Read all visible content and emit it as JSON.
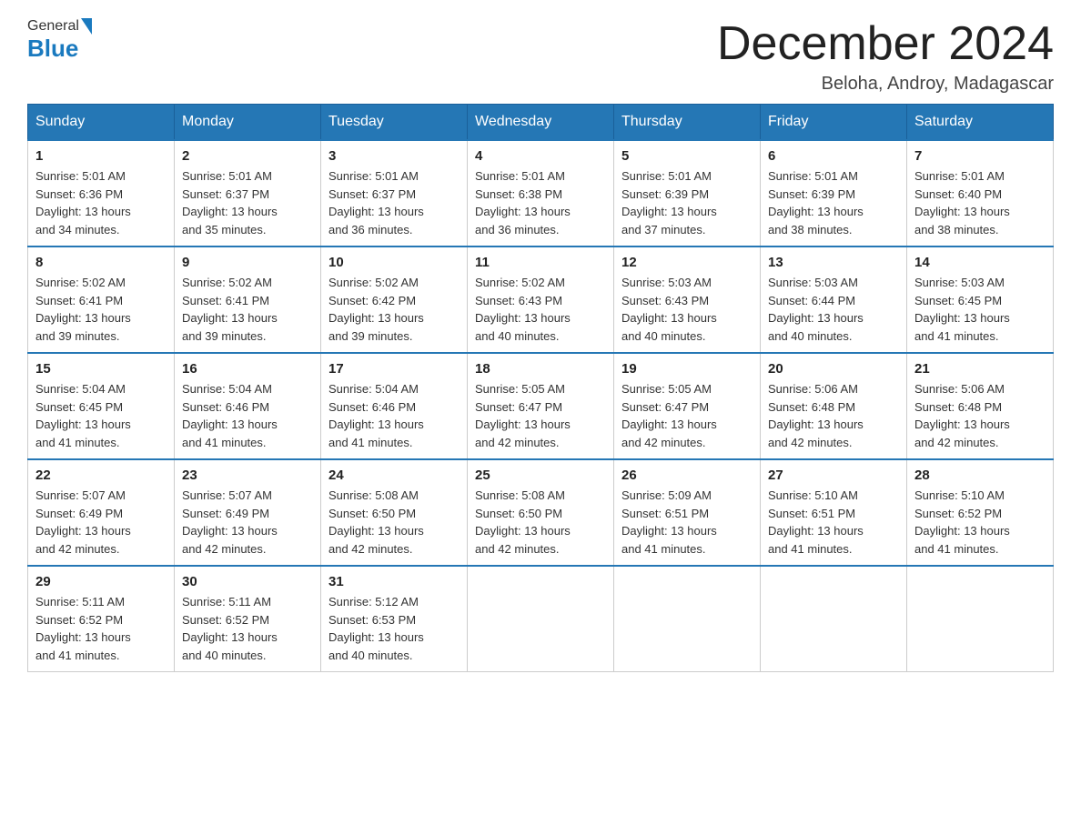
{
  "header": {
    "logo_general": "General",
    "logo_blue": "Blue",
    "month_title": "December 2024",
    "location": "Beloha, Androy, Madagascar"
  },
  "weekdays": [
    "Sunday",
    "Monday",
    "Tuesday",
    "Wednesday",
    "Thursday",
    "Friday",
    "Saturday"
  ],
  "weeks": [
    [
      {
        "day": "1",
        "sunrise": "5:01 AM",
        "sunset": "6:36 PM",
        "daylight": "13 hours and 34 minutes."
      },
      {
        "day": "2",
        "sunrise": "5:01 AM",
        "sunset": "6:37 PM",
        "daylight": "13 hours and 35 minutes."
      },
      {
        "day": "3",
        "sunrise": "5:01 AM",
        "sunset": "6:37 PM",
        "daylight": "13 hours and 36 minutes."
      },
      {
        "day": "4",
        "sunrise": "5:01 AM",
        "sunset": "6:38 PM",
        "daylight": "13 hours and 36 minutes."
      },
      {
        "day": "5",
        "sunrise": "5:01 AM",
        "sunset": "6:39 PM",
        "daylight": "13 hours and 37 minutes."
      },
      {
        "day": "6",
        "sunrise": "5:01 AM",
        "sunset": "6:39 PM",
        "daylight": "13 hours and 38 minutes."
      },
      {
        "day": "7",
        "sunrise": "5:01 AM",
        "sunset": "6:40 PM",
        "daylight": "13 hours and 38 minutes."
      }
    ],
    [
      {
        "day": "8",
        "sunrise": "5:02 AM",
        "sunset": "6:41 PM",
        "daylight": "13 hours and 39 minutes."
      },
      {
        "day": "9",
        "sunrise": "5:02 AM",
        "sunset": "6:41 PM",
        "daylight": "13 hours and 39 minutes."
      },
      {
        "day": "10",
        "sunrise": "5:02 AM",
        "sunset": "6:42 PM",
        "daylight": "13 hours and 39 minutes."
      },
      {
        "day": "11",
        "sunrise": "5:02 AM",
        "sunset": "6:43 PM",
        "daylight": "13 hours and 40 minutes."
      },
      {
        "day": "12",
        "sunrise": "5:03 AM",
        "sunset": "6:43 PM",
        "daylight": "13 hours and 40 minutes."
      },
      {
        "day": "13",
        "sunrise": "5:03 AM",
        "sunset": "6:44 PM",
        "daylight": "13 hours and 40 minutes."
      },
      {
        "day": "14",
        "sunrise": "5:03 AM",
        "sunset": "6:45 PM",
        "daylight": "13 hours and 41 minutes."
      }
    ],
    [
      {
        "day": "15",
        "sunrise": "5:04 AM",
        "sunset": "6:45 PM",
        "daylight": "13 hours and 41 minutes."
      },
      {
        "day": "16",
        "sunrise": "5:04 AM",
        "sunset": "6:46 PM",
        "daylight": "13 hours and 41 minutes."
      },
      {
        "day": "17",
        "sunrise": "5:04 AM",
        "sunset": "6:46 PM",
        "daylight": "13 hours and 41 minutes."
      },
      {
        "day": "18",
        "sunrise": "5:05 AM",
        "sunset": "6:47 PM",
        "daylight": "13 hours and 42 minutes."
      },
      {
        "day": "19",
        "sunrise": "5:05 AM",
        "sunset": "6:47 PM",
        "daylight": "13 hours and 42 minutes."
      },
      {
        "day": "20",
        "sunrise": "5:06 AM",
        "sunset": "6:48 PM",
        "daylight": "13 hours and 42 minutes."
      },
      {
        "day": "21",
        "sunrise": "5:06 AM",
        "sunset": "6:48 PM",
        "daylight": "13 hours and 42 minutes."
      }
    ],
    [
      {
        "day": "22",
        "sunrise": "5:07 AM",
        "sunset": "6:49 PM",
        "daylight": "13 hours and 42 minutes."
      },
      {
        "day": "23",
        "sunrise": "5:07 AM",
        "sunset": "6:49 PM",
        "daylight": "13 hours and 42 minutes."
      },
      {
        "day": "24",
        "sunrise": "5:08 AM",
        "sunset": "6:50 PM",
        "daylight": "13 hours and 42 minutes."
      },
      {
        "day": "25",
        "sunrise": "5:08 AM",
        "sunset": "6:50 PM",
        "daylight": "13 hours and 42 minutes."
      },
      {
        "day": "26",
        "sunrise": "5:09 AM",
        "sunset": "6:51 PM",
        "daylight": "13 hours and 41 minutes."
      },
      {
        "day": "27",
        "sunrise": "5:10 AM",
        "sunset": "6:51 PM",
        "daylight": "13 hours and 41 minutes."
      },
      {
        "day": "28",
        "sunrise": "5:10 AM",
        "sunset": "6:52 PM",
        "daylight": "13 hours and 41 minutes."
      }
    ],
    [
      {
        "day": "29",
        "sunrise": "5:11 AM",
        "sunset": "6:52 PM",
        "daylight": "13 hours and 41 minutes."
      },
      {
        "day": "30",
        "sunrise": "5:11 AM",
        "sunset": "6:52 PM",
        "daylight": "13 hours and 40 minutes."
      },
      {
        "day": "31",
        "sunrise": "5:12 AM",
        "sunset": "6:53 PM",
        "daylight": "13 hours and 40 minutes."
      },
      null,
      null,
      null,
      null
    ]
  ],
  "labels": {
    "sunrise": "Sunrise:",
    "sunset": "Sunset:",
    "daylight": "Daylight:"
  }
}
